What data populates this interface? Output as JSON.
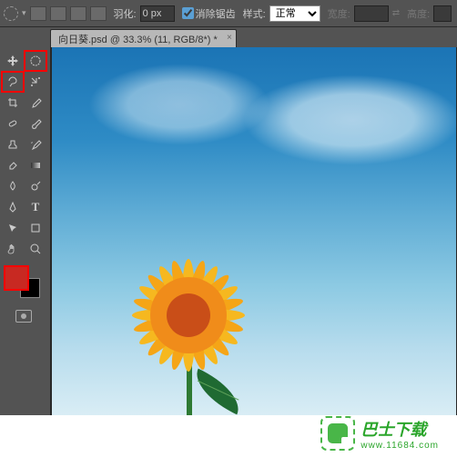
{
  "optbar": {
    "feather_label": "羽化:",
    "feather_value": "0 px",
    "antialias_label": "消除锯齿",
    "antialias_checked": true,
    "style_label": "样式:",
    "style_value": "正常",
    "width_label": "宽度:",
    "width_value": "",
    "height_label": "高度:",
    "height_value": ""
  },
  "tab": {
    "title": "向日葵.psd @ 33.3% (11, RGB/8*) *"
  },
  "tools": {
    "row0": [
      "move",
      "artboard"
    ],
    "row1": [
      "lasso",
      "add-anchor"
    ],
    "row2": [
      "crop",
      "eyedropper"
    ],
    "row3": [
      "patch",
      "brush"
    ],
    "row4": [
      "stamp",
      "history-brush"
    ],
    "row5": [
      "eraser",
      "gradient"
    ],
    "row6": [
      "blur",
      "dodge"
    ],
    "row7": [
      "pen",
      "type"
    ],
    "row8": [
      "path-select",
      "rectangle"
    ],
    "row9": [
      "hand",
      "zoom"
    ]
  },
  "colors": {
    "foreground": "#c82922",
    "background": "#000000"
  },
  "watermark": {
    "brand": "巴士下载",
    "url": "www.11684.com"
  }
}
